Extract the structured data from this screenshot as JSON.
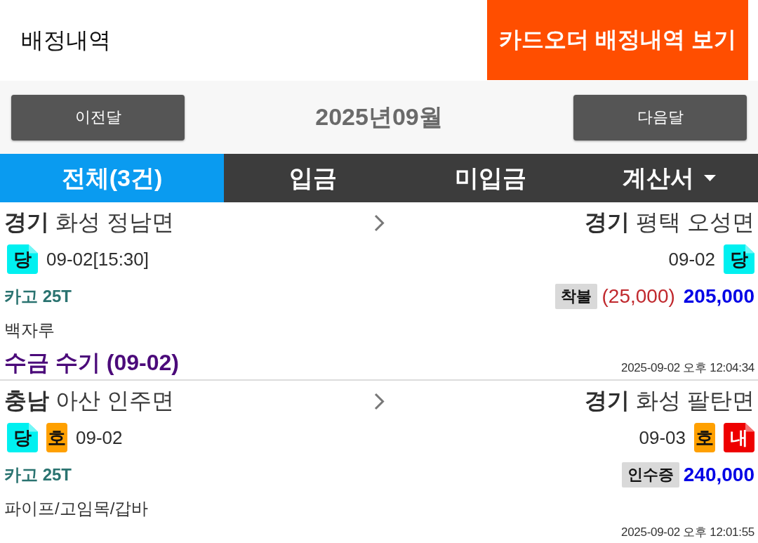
{
  "header": {
    "title": "배정내역",
    "card_order_button": "카드오더 배정내역 보기"
  },
  "month_nav": {
    "prev_button": "이전달",
    "month": "2025년09월",
    "next_button": "다음달"
  },
  "tabs": [
    {
      "label": "전체(3건)",
      "selected": true,
      "dropdown": false
    },
    {
      "label": "입금",
      "selected": false,
      "dropdown": false
    },
    {
      "label": "미입금",
      "selected": false,
      "dropdown": false
    },
    {
      "label": "계산서",
      "selected": false,
      "dropdown": true
    }
  ],
  "orders": [
    {
      "origin": "**경기** 화성 정남면",
      "destination": "**경기** 평택 오성면",
      "pickup": {
        "badges": [
          {
            "label": "당",
            "kind": "folded",
            "color": "#00f0f0"
          }
        ],
        "date": "09-02[15:30]"
      },
      "dropoff": {
        "date": "09-02",
        "badges": [
          {
            "label": "당",
            "kind": "folded",
            "color": "#00f0f0"
          }
        ]
      },
      "vehicle": "카고 25T",
      "payment_type": "착불",
      "deduction": "(25,000)",
      "amount": "205,000",
      "cargo": "백자루",
      "collection_note": "수금 수기 (09-02)",
      "timestamp": "2025-09-02 오후 12:04:34"
    },
    {
      "origin": "**충남** 아산 인주면",
      "destination": "**경기** 화성 팔탄면",
      "pickup": {
        "badges": [
          {
            "label": "당",
            "kind": "folded",
            "color": "#00f0f0"
          },
          {
            "label": "호",
            "kind": "plain",
            "color": "#ffa000"
          }
        ],
        "date": "09-02"
      },
      "dropoff": {
        "date": "09-03",
        "badges": [
          {
            "label": "호",
            "kind": "plain",
            "color": "#ffa000"
          },
          {
            "label": "내",
            "kind": "folded",
            "color": "#ee0000"
          }
        ]
      },
      "vehicle": "카고 25T",
      "payment_type": "인수증",
      "amount": "240,000",
      "cargo": "파이프/고임목/갑바",
      "timestamp": "2025-09-02 오후 12:01:55"
    }
  ]
}
